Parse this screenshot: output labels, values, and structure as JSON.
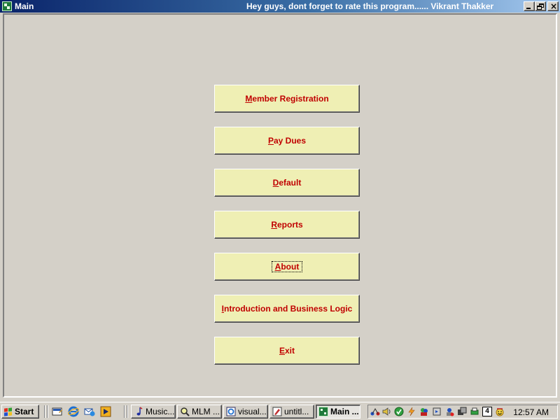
{
  "window": {
    "title": "Main",
    "title_message": "Hey guys, dont forget to rate this program...... Vikrant Thakker"
  },
  "menu": {
    "buttons": [
      {
        "accel": "M",
        "rest": "ember Registration"
      },
      {
        "accel": "P",
        "rest": "ay Dues"
      },
      {
        "accel": "D",
        "rest": "efault"
      },
      {
        "accel": "R",
        "rest": "eports"
      },
      {
        "accel": "A",
        "rest": "bout"
      },
      {
        "accel": "I",
        "rest": "ntroduction and Business Logic"
      },
      {
        "accel": "E",
        "rest": "xit"
      }
    ],
    "focused": "About",
    "colors": {
      "button_face": "#efefb4",
      "label": "#c00000",
      "client_bg": "#d4d0c8"
    }
  },
  "taskbar": {
    "start_label": "Start",
    "quick_launch": [
      "show-desktop-icon",
      "internet-explorer-icon",
      "outlook-express-icon",
      "media-player-icon"
    ],
    "tasks": [
      {
        "label": "Music...",
        "icon": "music-note-icon"
      },
      {
        "label": "MLM ...",
        "icon": "search-icon"
      },
      {
        "label": "visual...",
        "icon": "browser-icon"
      },
      {
        "label": "untitl...",
        "icon": "paint-icon"
      },
      {
        "label": "Main ...",
        "icon": "app-icon",
        "active": true
      }
    ],
    "tray_icons": [
      "network-icon",
      "volume-icon",
      "antivirus-icon",
      "flash-icon",
      "messenger-icon",
      "usb-icon",
      "network-2-icon",
      "security-icon",
      "printer-icon",
      "calendar-icon",
      "smiley-icon"
    ],
    "tray_date_day": "4",
    "clock": "12:57 AM"
  }
}
